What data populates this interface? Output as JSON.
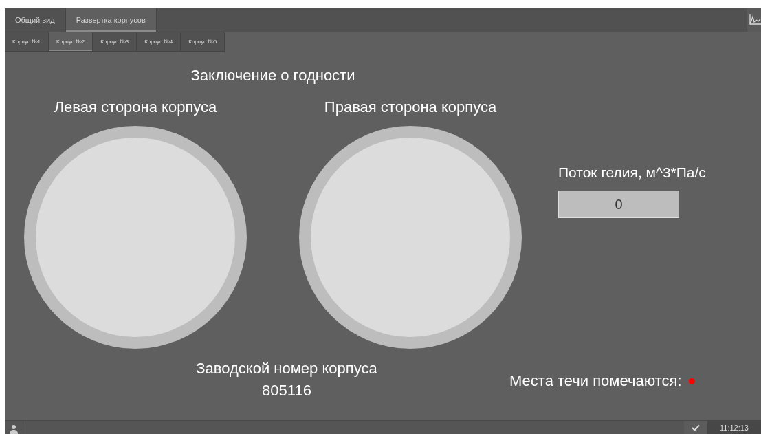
{
  "tabs": [
    {
      "label": "Общий вид",
      "selected": false
    },
    {
      "label": "Развертка корпусов",
      "selected": true
    }
  ],
  "subtabs": [
    {
      "label": "Корпус №1",
      "selected": false
    },
    {
      "label": "Корпус №2",
      "selected": true
    },
    {
      "label": "Корпус №3",
      "selected": false
    },
    {
      "label": "Корпус №4",
      "selected": false
    },
    {
      "label": "Корпус №5",
      "selected": false
    }
  ],
  "title": "Заключение о годности",
  "sides": [
    {
      "label": "Левая сторона корпуса"
    },
    {
      "label": "Правая сторона корпуса"
    }
  ],
  "flow": {
    "label": "Поток гелия, м^3*Па/с",
    "value": "0"
  },
  "serial": {
    "label": "Заводской номер корпуса",
    "value": "805116"
  },
  "leak": {
    "label": "Места течи помечаются:",
    "color": "#ff0000"
  },
  "status_bar": {
    "time": "11:12:13"
  }
}
